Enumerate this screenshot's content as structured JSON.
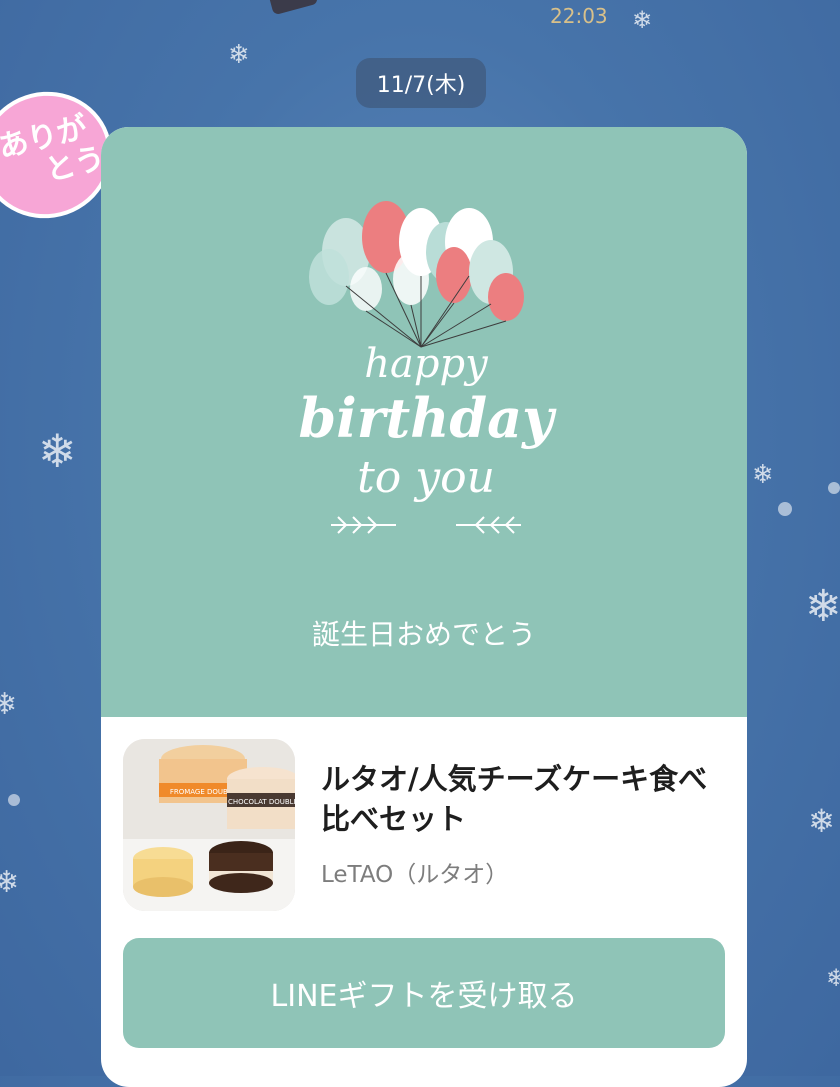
{
  "header": {
    "time": "22:03"
  },
  "date_chip": {
    "label": "11/7(木)"
  },
  "sticker": {
    "line1": "ありが",
    "line2": "とう"
  },
  "card": {
    "art_lines": [
      "happy",
      "birthday",
      "to you"
    ],
    "greeting": "誕生日おめでとう",
    "product": {
      "title": "ルタオ/人気チーズケーキ食べ比べセット",
      "brand": "LeTAO（ルタオ）",
      "thumb_labels": [
        "FROMAGE DOUBLE",
        "CHOCOLAT DOUBLE"
      ]
    },
    "cta_label": "LINEギフトを受け取る"
  },
  "colors": {
    "card_accent": "#8fc4b7",
    "background": "#4774aa",
    "sticker": "#f7a6d6"
  },
  "icons": [
    "snowflake-icon",
    "balloon-icon"
  ]
}
